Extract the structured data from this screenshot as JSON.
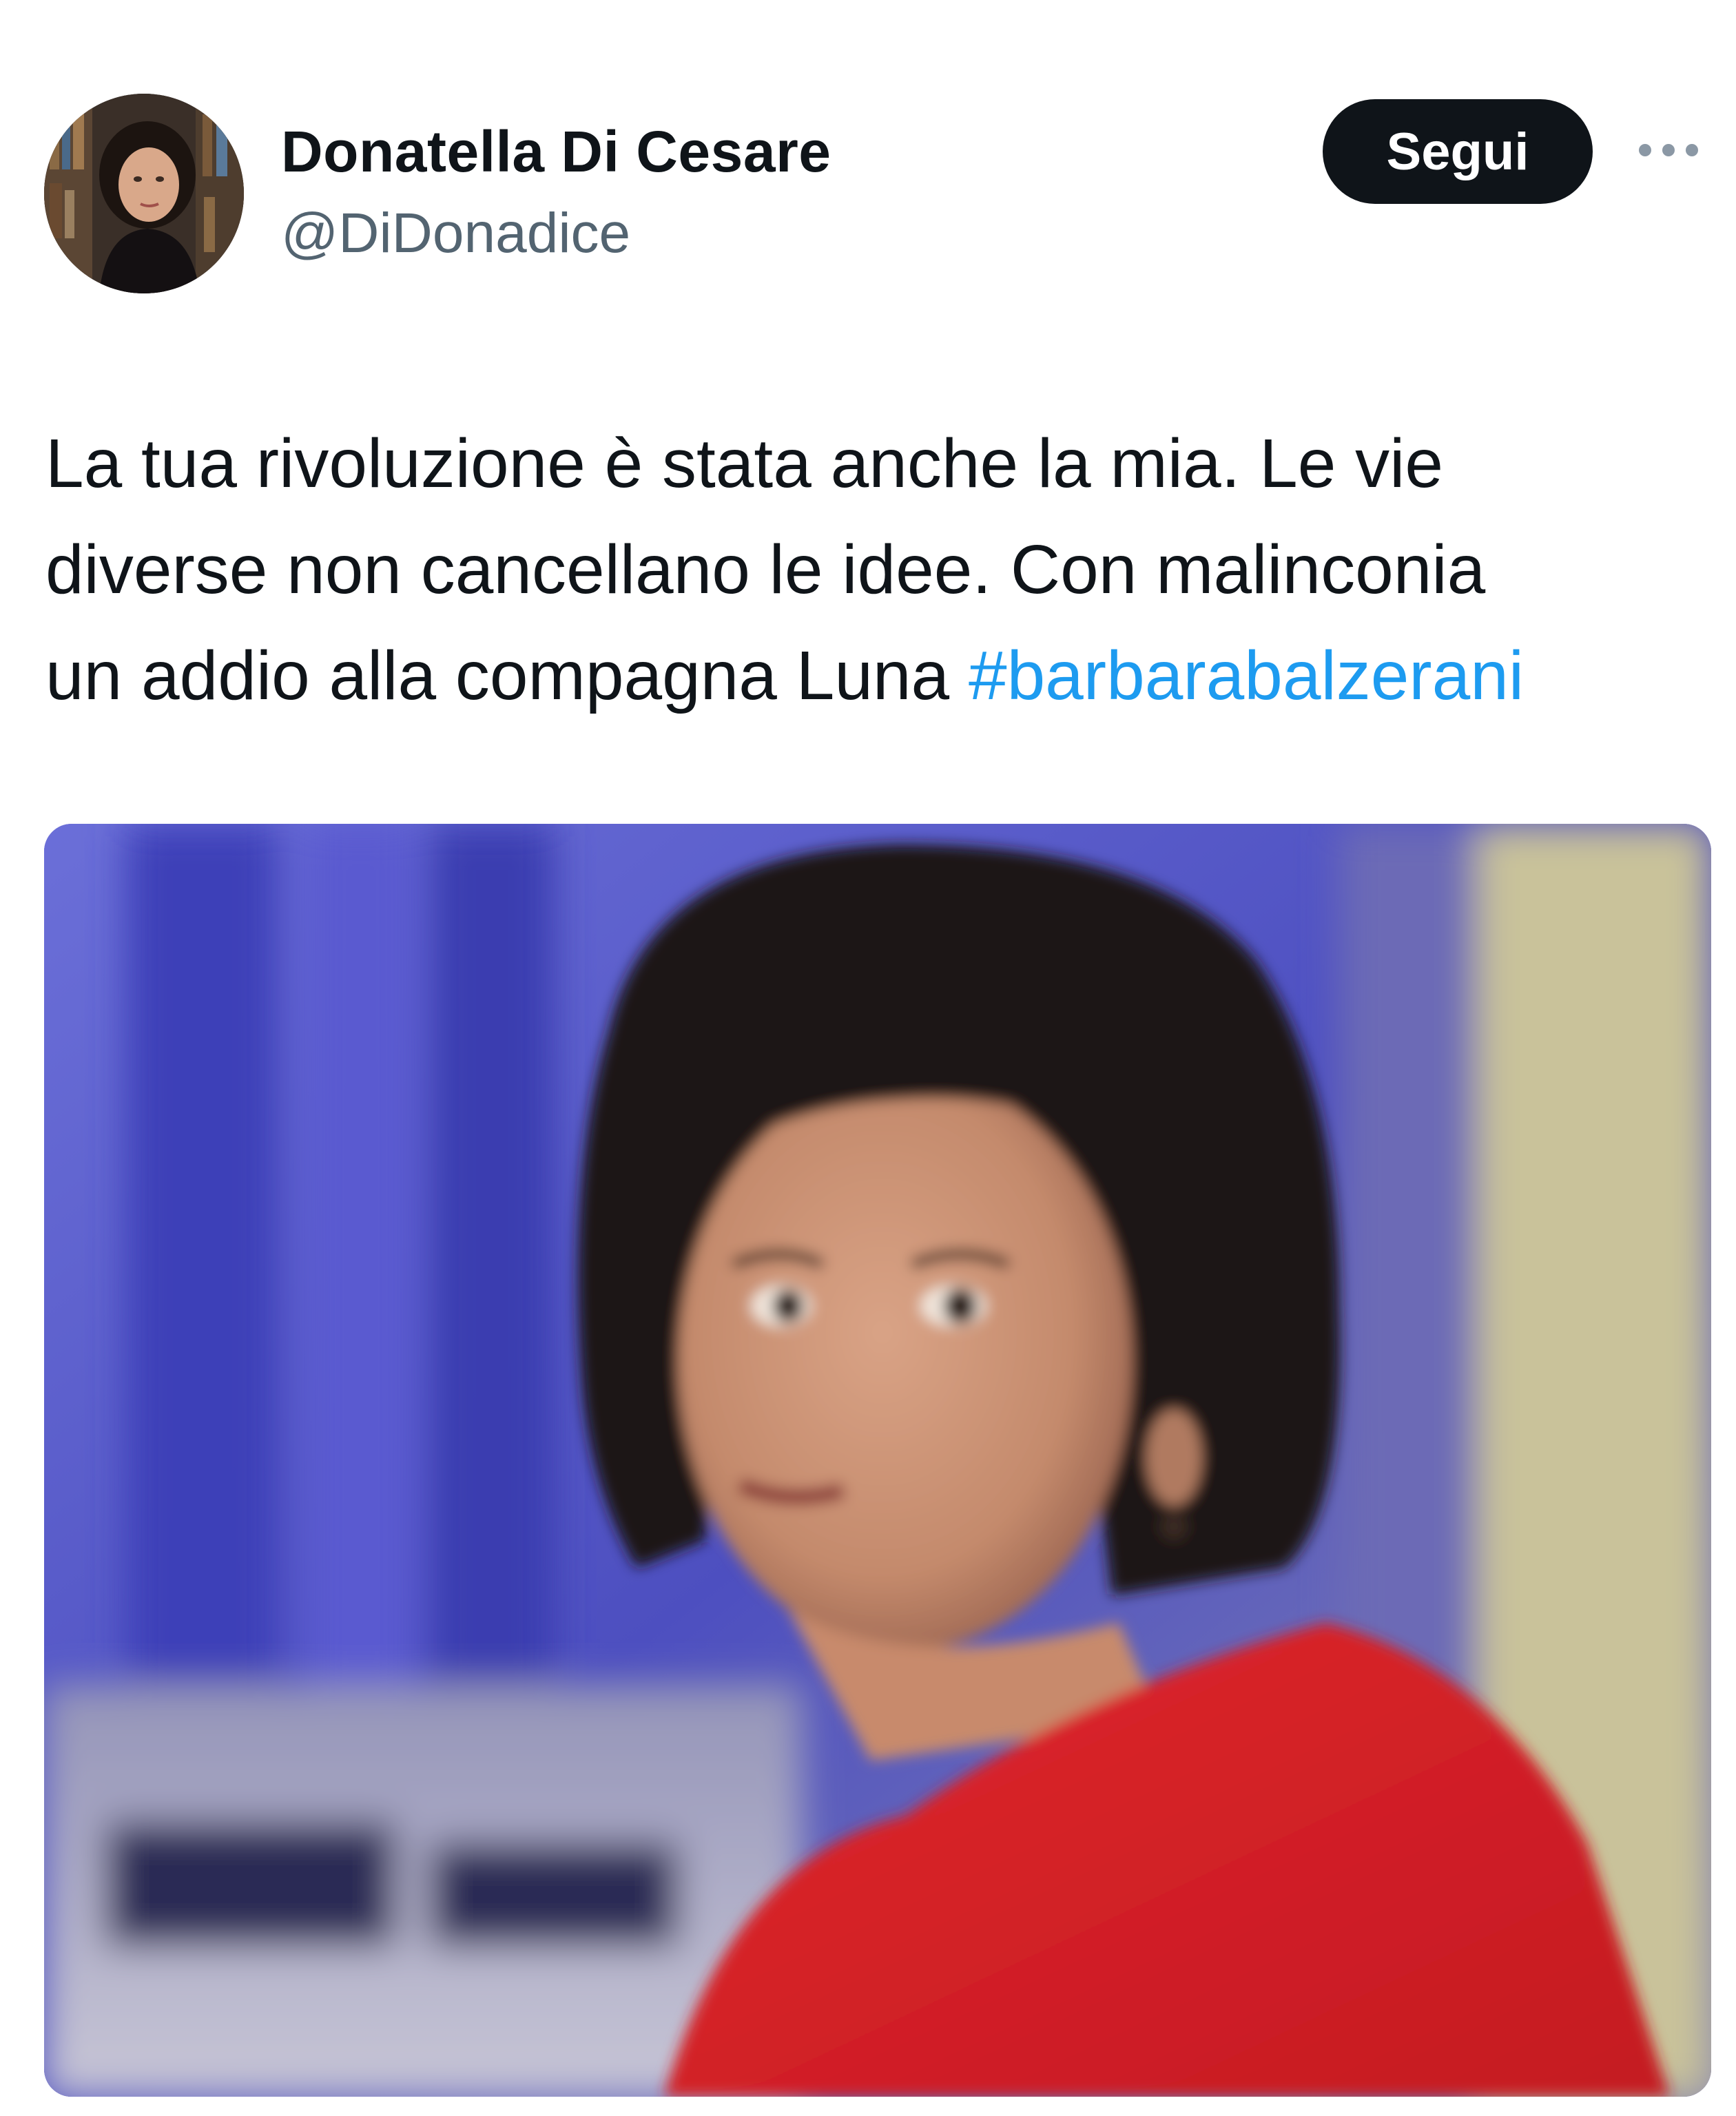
{
  "tweet": {
    "author": {
      "display_name": "Donatella Di Cesare",
      "handle": "@DiDonadice",
      "avatar_icon": "profile-photo"
    },
    "follow_button_label": "Segui",
    "more_icon": "more-horizontal-icon",
    "text_lines": [
      "La tua rivoluzione è stata anche la mia. Le vie",
      "diverse non cancellano le idee. Con malinconia",
      "un addio alla compagna Luna "
    ],
    "hashtag": "#barbarabalzerani",
    "colors": {
      "text": "#0f1419",
      "secondary": "#536471",
      "link": "#1d9bf0",
      "button_bg": "#0f1419",
      "button_text": "#ffffff"
    }
  }
}
